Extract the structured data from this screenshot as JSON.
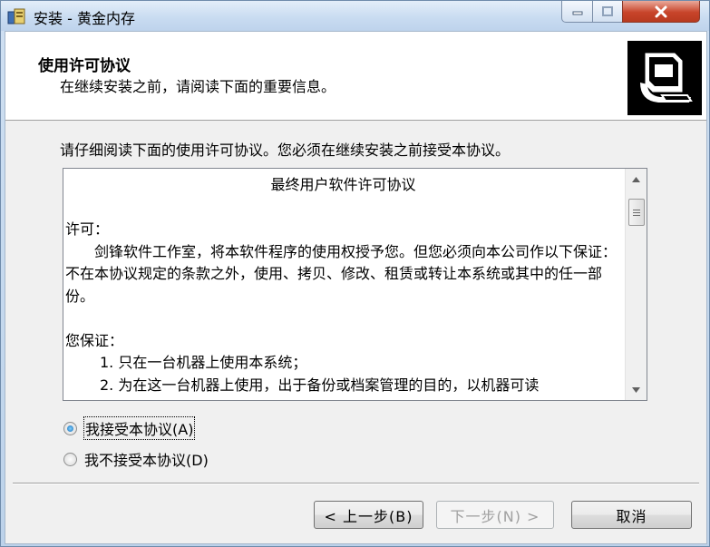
{
  "window": {
    "title": "安装 - 黄金内存"
  },
  "header": {
    "title": "使用许可协议",
    "subtitle": "在继续安装之前，请阅读下面的重要信息。",
    "logo_icon": "computer-installer-icon"
  },
  "prompt": "请仔细阅读下面的使用许可协议。您必须在继续安装之前接受本协议。",
  "license": {
    "heading": "最终用户软件许可协议",
    "section1_title": "许可：",
    "section1_body": "剑锋软件工作室，将本软件程序的使用权授予您。但您必须向本公司作以下保证：不在本协议规定的条款之外，使用、拷贝、修改、租赁或转让本系统或其中的任一部份。",
    "section2_title": "您保证：",
    "item1": "1. 只在一台机器上使用本系统；",
    "item2": "2. 为在这一台机器上使用，出于备份或档案管理的目的，以机器可读"
  },
  "options": {
    "accept": "我接受本协议(A)",
    "decline": "我不接受本协议(D)",
    "selected": "accept"
  },
  "buttons": {
    "back": "< 上一步(B)",
    "next": "下一步(N) >",
    "cancel": "取消"
  }
}
